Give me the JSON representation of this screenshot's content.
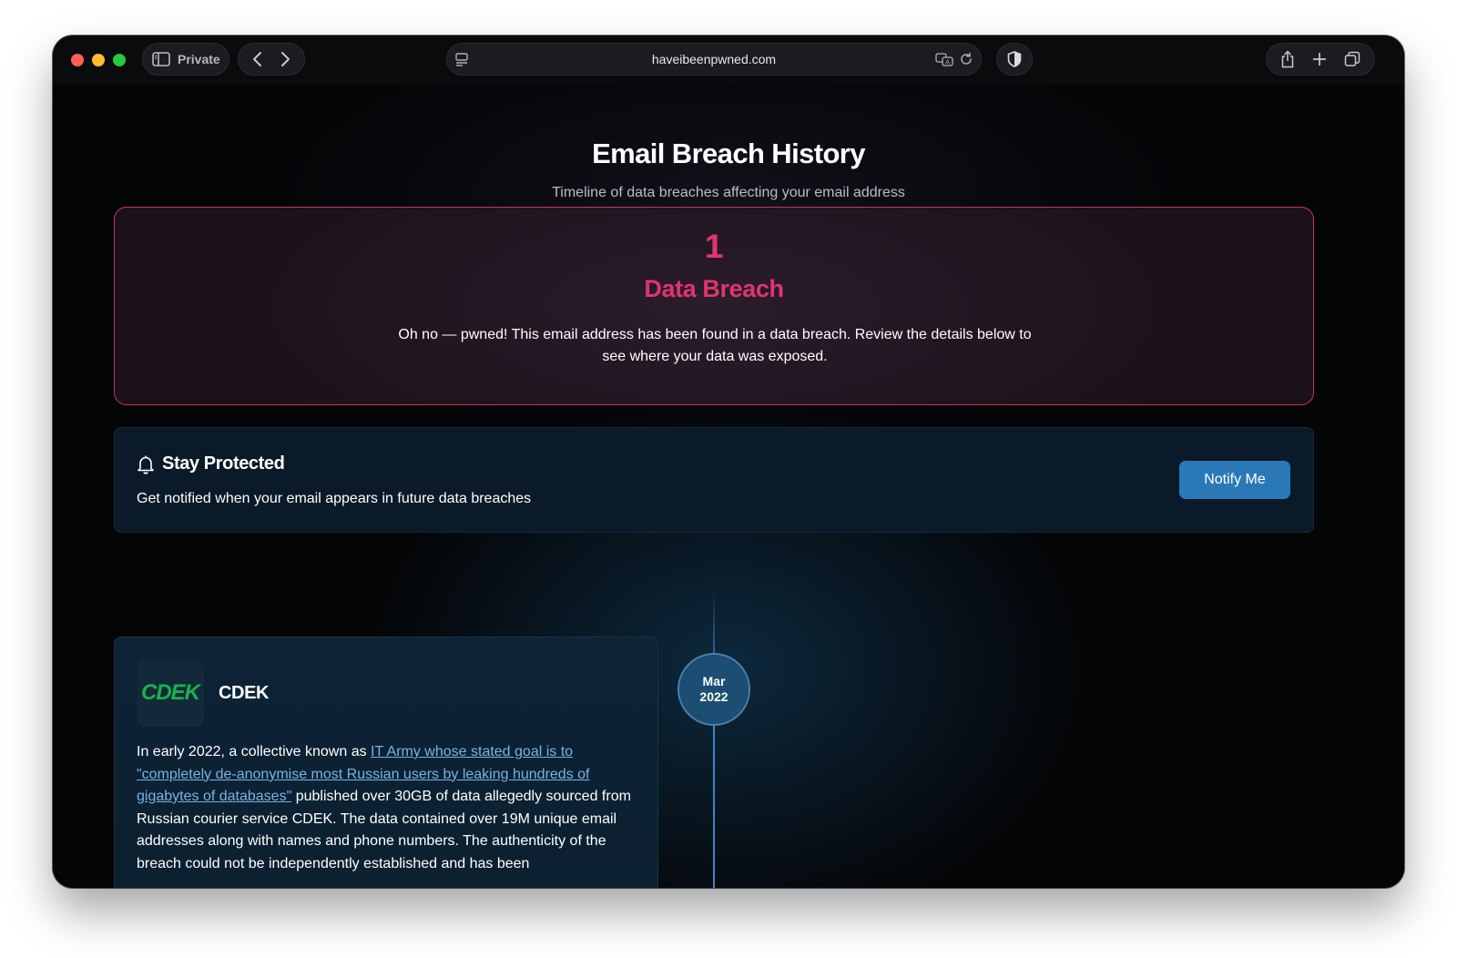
{
  "browser": {
    "private_label": "Private",
    "url": "haveibeenpwned.com",
    "icons": [
      "sidebar-icon",
      "back-icon",
      "forward-icon",
      "page-menu-icon",
      "translate-icon",
      "reload-icon",
      "shield-icon",
      "share-icon",
      "plus-icon",
      "tabs-icon"
    ]
  },
  "header": {
    "title": "Email Breach History",
    "subtitle": "Timeline of data breaches affecting your email address"
  },
  "summary": {
    "count": "1",
    "label": "Data Breach",
    "message": "Oh no — pwned! This email address has been found in a data breach. Review the details below to see where your data was exposed."
  },
  "protect": {
    "title": "Stay Protected",
    "text": "Get notified when your email appears in future data breaches",
    "button": "Notify Me"
  },
  "timeline": [
    {
      "month": "Mar",
      "year": "2022",
      "logo_text": "CDEK",
      "name": "CDEK",
      "desc_before": "In early 2022, a collective known as ",
      "desc_link": "IT Army whose stated goal is to \"completely de-anonymise most Russian users by leaking hundreds of gigabytes of databases\"",
      "desc_after": " published over 30GB of data allegedly sourced from Russian courier service CDEK. The data contained over 19M unique email addresses along with names and phone numbers. The authenticity of the breach could not be independently established and has been"
    }
  ],
  "colors": {
    "accent_pink": "#e0356d",
    "button_blue": "#2a79b6",
    "logo_green": "#19b24b",
    "link_blue": "#79b3e3"
  }
}
